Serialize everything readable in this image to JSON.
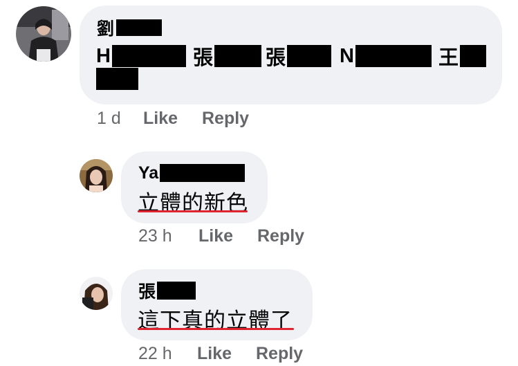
{
  "comments": [
    {
      "author_visible": "劉",
      "mentions": [
        "H",
        "張",
        "張",
        "N",
        "王"
      ],
      "time": "1 d",
      "like_label": "Like",
      "reply_label": "Reply"
    },
    {
      "author_visible": "Ya",
      "text": "立體的新色",
      "time": "23 h",
      "like_label": "Like",
      "reply_label": "Reply"
    },
    {
      "author_visible": "張",
      "text": "這下真的立體了",
      "time": "22 h",
      "like_label": "Like",
      "reply_label": "Reply"
    }
  ],
  "colors": {
    "bubble": "#eff1f4",
    "meta_text": "#65676b",
    "underline": "#e0242f",
    "redaction": "#000000"
  }
}
